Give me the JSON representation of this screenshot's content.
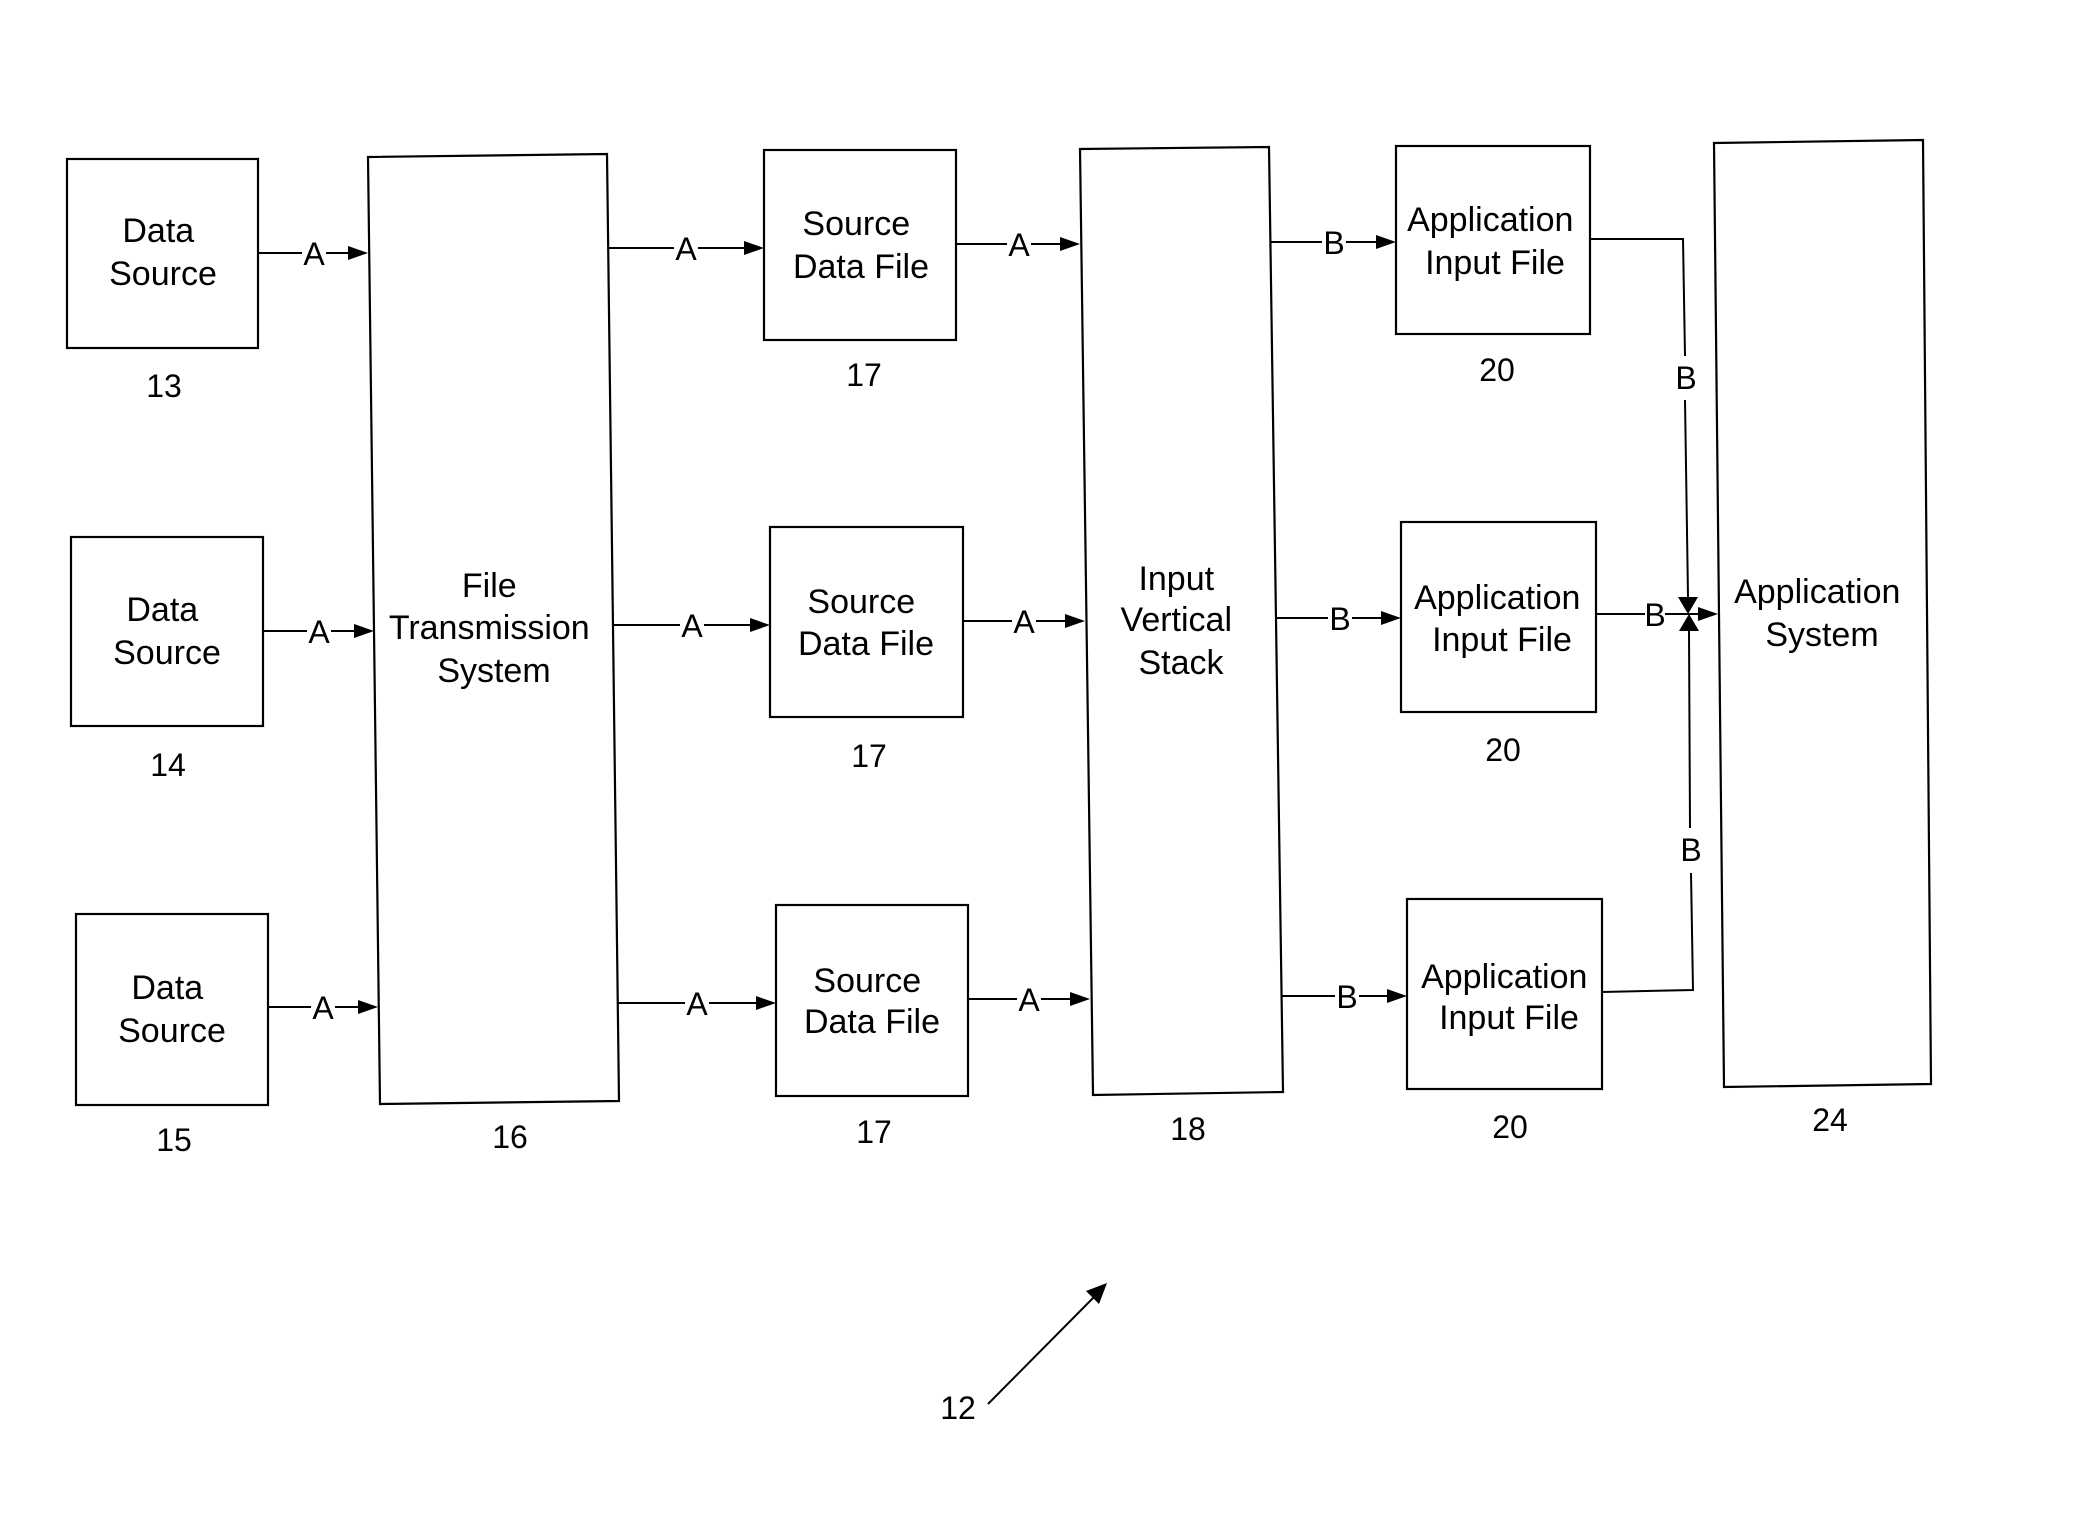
{
  "figure": {
    "reference_number": "12"
  },
  "nodes": {
    "data_source_13": {
      "lines": [
        "Data",
        "Source"
      ],
      "ref": "13"
    },
    "data_source_14": {
      "lines": [
        "Data",
        "Source"
      ],
      "ref": "14"
    },
    "data_source_15": {
      "lines": [
        "Data",
        "Source"
      ],
      "ref": "15"
    },
    "file_transmission_system": {
      "lines": [
        "File",
        "Transmission",
        "System"
      ],
      "ref": "16"
    },
    "source_data_file_1": {
      "lines": [
        "Source",
        "Data File"
      ],
      "ref": "17"
    },
    "source_data_file_2": {
      "lines": [
        "Source",
        "Data File"
      ],
      "ref": "17"
    },
    "source_data_file_3": {
      "lines": [
        "Source",
        "Data File"
      ],
      "ref": "17"
    },
    "input_vertical_stack": {
      "lines": [
        "Input",
        "Vertical",
        "Stack"
      ],
      "ref": "18"
    },
    "application_input_file_1": {
      "lines": [
        "Application",
        "Input File"
      ],
      "ref": "20"
    },
    "application_input_file_2": {
      "lines": [
        "Application",
        "Input File"
      ],
      "ref": "20"
    },
    "application_input_file_3": {
      "lines": [
        "Application",
        "Input File"
      ],
      "ref": "20"
    },
    "application_system": {
      "lines": [
        "Application",
        "System"
      ],
      "ref": "24"
    }
  },
  "edges": {
    "ds13_to_fts": {
      "from": "data_source_13",
      "to": "file_transmission_system",
      "label": "A"
    },
    "ds14_to_fts": {
      "from": "data_source_14",
      "to": "file_transmission_system",
      "label": "A"
    },
    "ds15_to_fts": {
      "from": "data_source_15",
      "to": "file_transmission_system",
      "label": "A"
    },
    "fts_to_sdf1": {
      "from": "file_transmission_system",
      "to": "source_data_file_1",
      "label": "A"
    },
    "fts_to_sdf2": {
      "from": "file_transmission_system",
      "to": "source_data_file_2",
      "label": "A"
    },
    "fts_to_sdf3": {
      "from": "file_transmission_system",
      "to": "source_data_file_3",
      "label": "A"
    },
    "sdf1_to_ivs": {
      "from": "source_data_file_1",
      "to": "input_vertical_stack",
      "label": "A"
    },
    "sdf2_to_ivs": {
      "from": "source_data_file_2",
      "to": "input_vertical_stack",
      "label": "A"
    },
    "sdf3_to_ivs": {
      "from": "source_data_file_3",
      "to": "input_vertical_stack",
      "label": "A"
    },
    "ivs_to_aif1": {
      "from": "input_vertical_stack",
      "to": "application_input_file_1",
      "label": "B"
    },
    "ivs_to_aif2": {
      "from": "input_vertical_stack",
      "to": "application_input_file_2",
      "label": "B"
    },
    "ivs_to_aif3": {
      "from": "input_vertical_stack",
      "to": "application_input_file_3",
      "label": "B"
    },
    "aif1_to_as": {
      "from": "application_input_file_1",
      "to": "application_system",
      "label": "B"
    },
    "aif2_to_as": {
      "from": "application_input_file_2",
      "to": "application_system",
      "label": "B"
    },
    "aif3_to_as": {
      "from": "application_input_file_3",
      "to": "application_system",
      "label": "B"
    }
  }
}
